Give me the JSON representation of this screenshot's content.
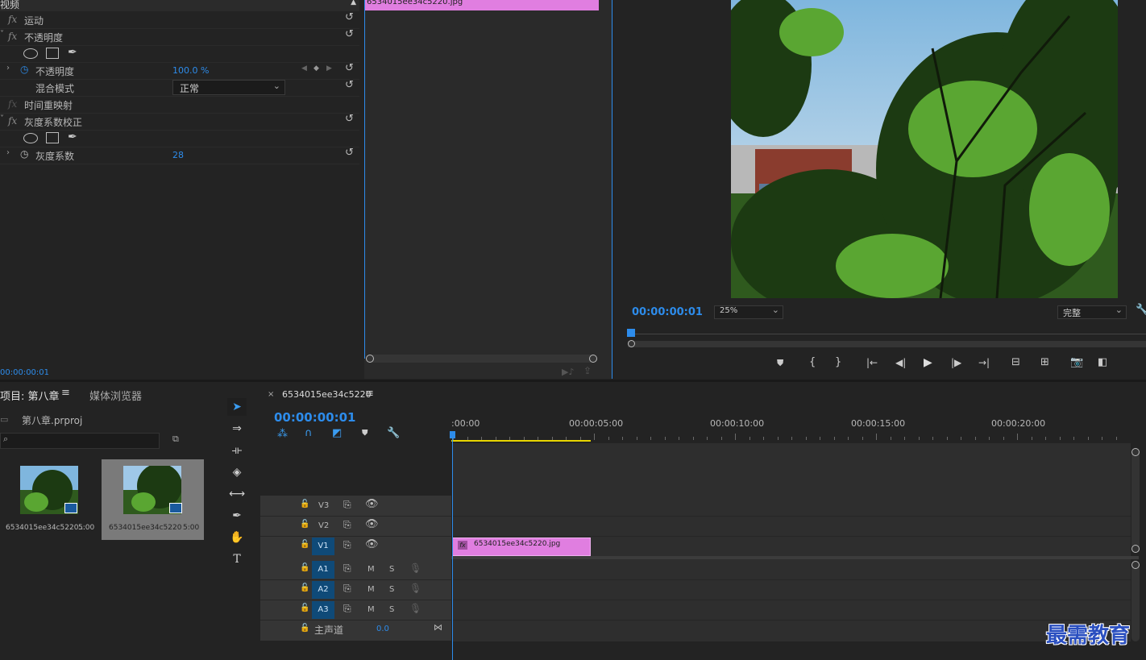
{
  "effect_controls": {
    "section_video": "视频",
    "motion_label": "运动",
    "opacity_group_label": "不透明度",
    "opacity_param_label": "不透明度",
    "opacity_value": "100.0 %",
    "blend_mode_label": "混合模式",
    "blend_mode_value": "正常",
    "time_remap_label": "时间重映射",
    "gamma_group_label": "灰度系数校正",
    "gamma_param_label": "灰度系数",
    "gamma_value": "28",
    "fx_glyph": "fx",
    "timecode": "00:00:00:01"
  },
  "ec_timeline": {
    "clip_name": "6534015ee34c5220.jpg"
  },
  "program_monitor": {
    "timecode": "00:00:00:01",
    "zoom": "25%",
    "quality": "完整"
  },
  "project_panel": {
    "tab_project": "项目: 第八章",
    "tab_media_browser": "媒体浏览器",
    "project_file": "第八章.prproj",
    "search_placeholder": "",
    "items": [
      {
        "name": "6534015ee34c5220...",
        "duration": "5:00"
      },
      {
        "name": "6534015ee34c5220",
        "duration": "5:00"
      }
    ]
  },
  "timeline": {
    "sequence_tab": "6534015ee34c5220",
    "timecode": "00:00:00:01",
    "ruler_labels": [
      ":00:00",
      "00:00:05:00",
      "00:00:10:00",
      "00:00:15:00",
      "00:00:20:00"
    ],
    "video_tracks": [
      "V3",
      "V2",
      "V1"
    ],
    "audio_tracks": [
      "A1",
      "A2",
      "A3"
    ],
    "master_label": "主声道",
    "master_value": "0.0",
    "mute_label": "M",
    "solo_label": "S",
    "clip_name": "6534015ee34c5220.jpg",
    "clip_fx": "fx"
  },
  "watermark": "最需教育",
  "colors": {
    "accent_blue": "#2d8ceb",
    "clip_pink": "#e07ee0",
    "track_blue": "#0f4a78"
  }
}
